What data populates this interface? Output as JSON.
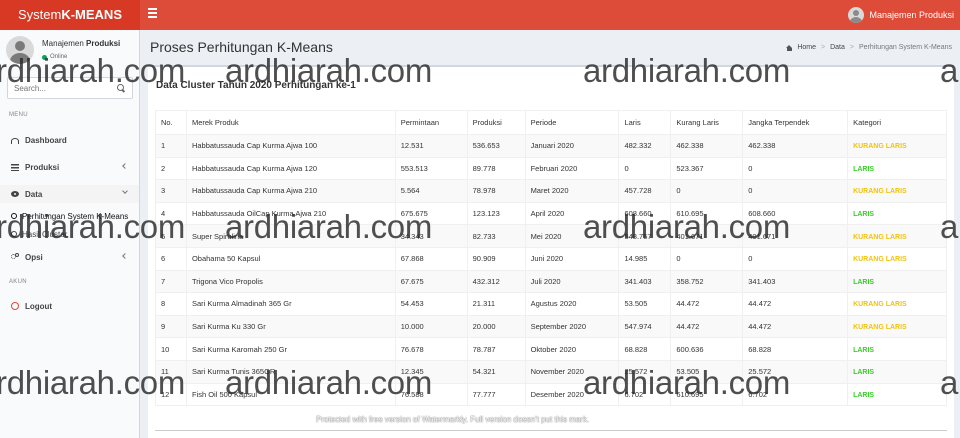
{
  "app": {
    "logo_prefix": "System",
    "logo_bold": "K-MEANS"
  },
  "topbar": {
    "user": "Manajemen Produksi"
  },
  "sidebar": {
    "user_name_prefix": "Manajemen ",
    "user_name_bold": "Produksi",
    "status": "Online",
    "search_placeholder": "Search...",
    "menu_header": "MENU",
    "akun_header": "AKUN",
    "items": {
      "dashboard": "Dashboard",
      "produksi": "Produksi",
      "data": "Data",
      "opsi": "Opsi",
      "logout": "Logout"
    },
    "sub": {
      "perhitungan": "Perhitungan System K-Means",
      "hasil": "Hasil Cluster"
    }
  },
  "header": {
    "title": "Proses Perhitungan K-Means",
    "breadcrumb": {
      "home": "Home",
      "data": "Data",
      "current": "Perhitungan System K-Means"
    }
  },
  "box": {
    "title": "Data Cluster Tahun 2020 Perhitungan ke-1"
  },
  "table": {
    "columns": [
      "No.",
      "Merek Produk",
      "Permintaan",
      "Produksi",
      "Periode",
      "Laris",
      "Kurang Laris",
      "Jangka Terpendek",
      "Kategori"
    ],
    "rows": [
      [
        "1",
        "Habbatussauda Cap Kurma Ajwa 100",
        "12.531",
        "536.653",
        "Januari 2020",
        "482.332",
        "462.338",
        "462.338",
        "KURANG LARIS"
      ],
      [
        "2",
        "Habbatussauda Cap Kurma Ajwa 120",
        "553.513",
        "89.778",
        "Februari 2020",
        "0",
        "523.367",
        "0",
        "LARIS"
      ],
      [
        "3",
        "Habbatussauda Cap Kurma Ajwa 210",
        "5.564",
        "78.978",
        "Maret 2020",
        "457.728",
        "0",
        "0",
        "KURANG LARIS"
      ],
      [
        "4",
        "Habbatussauda OilCap Kurma Ajwa 210",
        "675.675",
        "123.123",
        "April 2020",
        "608.660",
        "610.695",
        "608.660",
        "LARIS"
      ],
      [
        "5",
        "Super Spirulina",
        "34.343",
        "82.733",
        "Mei 2020",
        "548.757",
        "401.671",
        "401.671",
        "KURANG LARIS"
      ],
      [
        "6",
        "Obahama 50 Kapsul",
        "67.868",
        "90.909",
        "Juni 2020",
        "14.985",
        "0",
        "0",
        "KURANG LARIS"
      ],
      [
        "7",
        "Trigona Vico Propolis",
        "67.675",
        "432.312",
        "Juli 2020",
        "341.403",
        "358.752",
        "341.403",
        "LARIS"
      ],
      [
        "8",
        "Sari Kurma Almadinah 365 Gr",
        "54.453",
        "21.311",
        "Agustus 2020",
        "53.505",
        "44.472",
        "44.472",
        "KURANG LARIS"
      ],
      [
        "9",
        "Sari Kurma Ku 330 Gr",
        "10.000",
        "20.000",
        "September 2020",
        "547.974",
        "44.472",
        "44.472",
        "KURANG LARIS"
      ],
      [
        "10",
        "Sari Kurma Karomah 250 Gr",
        "76.678",
        "78.787",
        "Oktober 2020",
        "68.828",
        "600.636",
        "68.828",
        "LARIS"
      ],
      [
        "11",
        "Sari Kurma Tunis 365GR",
        "12.345",
        "54.321",
        "November 2020",
        "25.572",
        "53.505",
        "25.572",
        "LARIS"
      ],
      [
        "12",
        "Fish Oil 500 Kapsul",
        "76.588",
        "77.777",
        "Desember 2020",
        "6.702",
        "610.695",
        "6.702",
        "LARIS"
      ]
    ]
  },
  "watermark": {
    "text": "ardhiarah.com",
    "note": "Protected with free version of Watermarkly. Full version doesn't put this mark."
  },
  "colors": {
    "topbar": "#dd4b39",
    "logo_bg": "#d73925",
    "laris": "#39ce2a",
    "kurang_laris": "#f0c30f"
  }
}
